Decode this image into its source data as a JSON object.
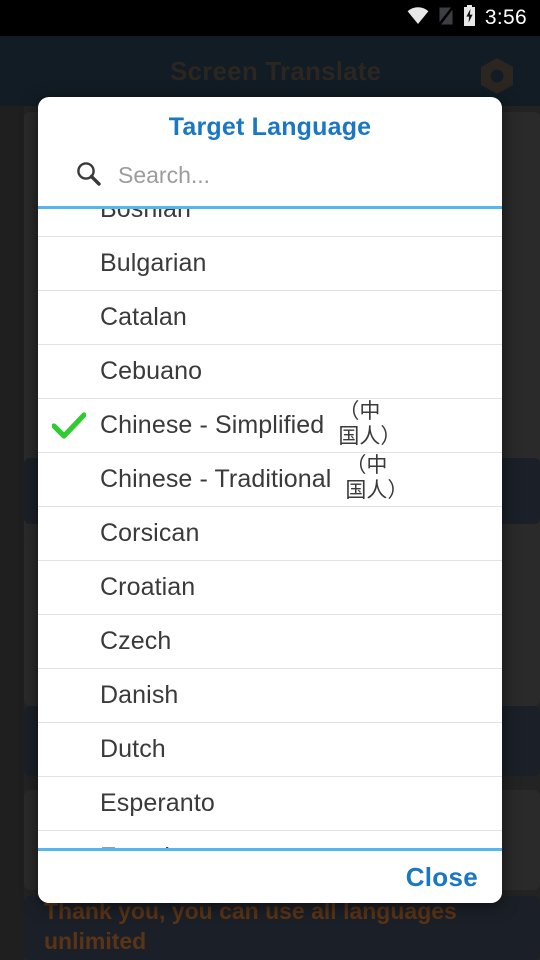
{
  "statusbar": {
    "time": "3:56",
    "icons": [
      "wifi-icon",
      "no-sim-icon",
      "battery-charging-icon"
    ]
  },
  "app": {
    "title": "Screen Translate",
    "settings_icon": "hex-nut-gear-icon",
    "notice": "Thank you, you can use all languages unlimited"
  },
  "dialog": {
    "title": "Target Language",
    "search": {
      "icon": "search-icon",
      "value": "",
      "placeholder": "Search..."
    },
    "accent_color": "#1a77c4",
    "divider_color": "#55b5ef",
    "check_color": "#2ecc2e",
    "selected": "Chinese - Simplified",
    "items": [
      {
        "label": "Bosnian",
        "native": "",
        "selected": false
      },
      {
        "label": "Bulgarian",
        "native": "",
        "selected": false
      },
      {
        "label": "Catalan",
        "native": "",
        "selected": false
      },
      {
        "label": "Cebuano",
        "native": "",
        "selected": false
      },
      {
        "label": "Chinese - Simplified",
        "native": "（中国人）",
        "selected": true
      },
      {
        "label": "Chinese - Traditional",
        "native": "（中国人）",
        "selected": false
      },
      {
        "label": "Corsican",
        "native": "",
        "selected": false
      },
      {
        "label": "Croatian",
        "native": "",
        "selected": false
      },
      {
        "label": "Czech",
        "native": "",
        "selected": false
      },
      {
        "label": "Danish",
        "native": "",
        "selected": false
      },
      {
        "label": "Dutch",
        "native": "",
        "selected": false
      },
      {
        "label": "Esperanto",
        "native": "",
        "selected": false
      },
      {
        "label": "Estonian",
        "native": "",
        "selected": false
      }
    ],
    "close_label": "Close"
  }
}
